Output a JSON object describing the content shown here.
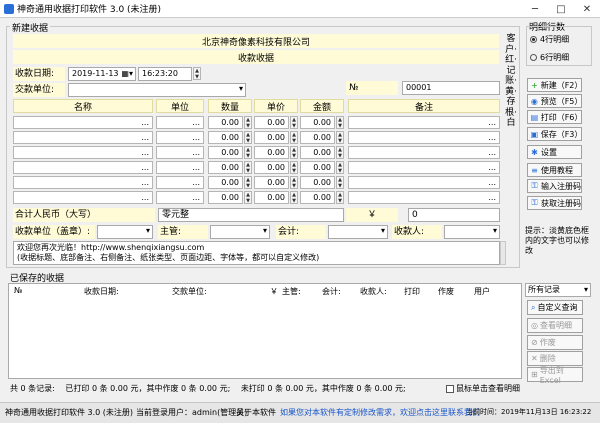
{
  "window": {
    "title": "神奇通用收据打印软件 3.0 (未注册)",
    "controls": [
      "─",
      "□",
      "✕"
    ]
  },
  "new_receipt": {
    "group_label": "新建收据",
    "company": "北京神奇像素科技有限公司",
    "doc_title": "收款收据",
    "date_label": "收款日期:",
    "date": "2019-11-13",
    "time": "16:23:20",
    "payer_label": "交款单位:",
    "payer_value": "",
    "no_label": "№",
    "no_value": "00001",
    "columns": [
      "名称",
      "单位",
      "数量",
      "单价",
      "金额",
      "备注"
    ],
    "rows": [
      {
        "name": "...",
        "unit": "...",
        "qty": "0.00",
        "price": "0.00",
        "amount": "0.00",
        "note": "..."
      },
      {
        "name": "...",
        "unit": "...",
        "qty": "0.00",
        "price": "0.00",
        "amount": "0.00",
        "note": "..."
      },
      {
        "name": "...",
        "unit": "...",
        "qty": "0.00",
        "price": "0.00",
        "amount": "0.00",
        "note": "..."
      },
      {
        "name": "...",
        "unit": "...",
        "qty": "0.00",
        "price": "0.00",
        "amount": "0.00",
        "note": "..."
      },
      {
        "name": "...",
        "unit": "...",
        "qty": "0.00",
        "price": "0.00",
        "amount": "0.00",
        "note": "..."
      },
      {
        "name": "...",
        "unit": "...",
        "qty": "0.00",
        "price": "0.00",
        "amount": "0.00",
        "note": "..."
      }
    ],
    "total_rmb_label": "合计人民币（大写）",
    "total_rmb_value": "零元整",
    "currency_symbol": "￥",
    "total_value": "0",
    "payee_label": "收款单位（盖章）:",
    "supervisor_label": "主管:",
    "accountant_label": "会计:",
    "receiver_label": "收款人:",
    "remark_lines": [
      "欢迎您再次光临！http://www.shenqixiangsu.com",
      "(收据标题、底部备注、右侧备注、纸张类型、页面边距、字体等，都可以自定义修改)"
    ],
    "side_text": "客户·红·记账·黄·存根·白"
  },
  "detail_rows": {
    "label": "明细行数",
    "options": [
      "4行明细",
      "6行明细"
    ],
    "selected": 0
  },
  "toolbar": [
    {
      "icon": "plus-icon",
      "label": "新建（F2）",
      "color": "#1aa01a"
    },
    {
      "icon": "preview-icon",
      "label": "预览（F5）",
      "color": "#2a6fd8"
    },
    {
      "icon": "print-icon",
      "label": "打印（F6）",
      "color": "#2a6fd8"
    },
    {
      "icon": "save-icon",
      "label": "保存（F3）",
      "color": "#2a6fd8"
    },
    {
      "icon": "gear-icon",
      "label": "设置",
      "color": "#2a6fd8"
    },
    {
      "icon": "book-icon",
      "label": "使用教程",
      "color": "#2a6fd8"
    },
    {
      "icon": "key-icon",
      "label": "输入注册码",
      "color": "#2a6fd8"
    },
    {
      "icon": "get-key-icon",
      "label": "获取注册码",
      "color": "#2a6fd8"
    }
  ],
  "tip": "提示：淡黄底色框内的文字也可以修改",
  "saved": {
    "group_label": "已保存的收据",
    "columns": [
      "№",
      "收款日期:",
      "交款单位:",
      "￥",
      "主管:",
      "会计:",
      "收款人:",
      "打印",
      "作废",
      "用户"
    ],
    "filter_value": "所有记录",
    "buttons": [
      {
        "icon": "search-icon",
        "label": "自定义查询",
        "enabled": true
      },
      {
        "icon": "view-icon",
        "label": "查看明细",
        "enabled": false
      },
      {
        "icon": "void-icon",
        "label": "作废",
        "enabled": false
      },
      {
        "icon": "delete-icon",
        "label": "删除",
        "enabled": false
      },
      {
        "icon": "excel-icon",
        "label": "导出到Excel",
        "enabled": false
      }
    ]
  },
  "summary": {
    "records": "共 0 条记录:",
    "printed": "已打印 0 条 0.00 元，其中作废 0 条 0.00 元;",
    "unprinted": "未打印 0 条 0.00 元，其中作废 0 条 0.00 元;",
    "checkbox_label": "鼠标单击查看明细"
  },
  "status": {
    "app": "神奇通用收据打印软件 3.0 (未注册)",
    "user": "当前登录用户：admin(管理员)",
    "about": "关于本软件",
    "link": "如果您对本软件有定制修改需求，欢迎点击这里联系我们",
    "time": "当前时间：2019年11月13日 16:23:22"
  }
}
